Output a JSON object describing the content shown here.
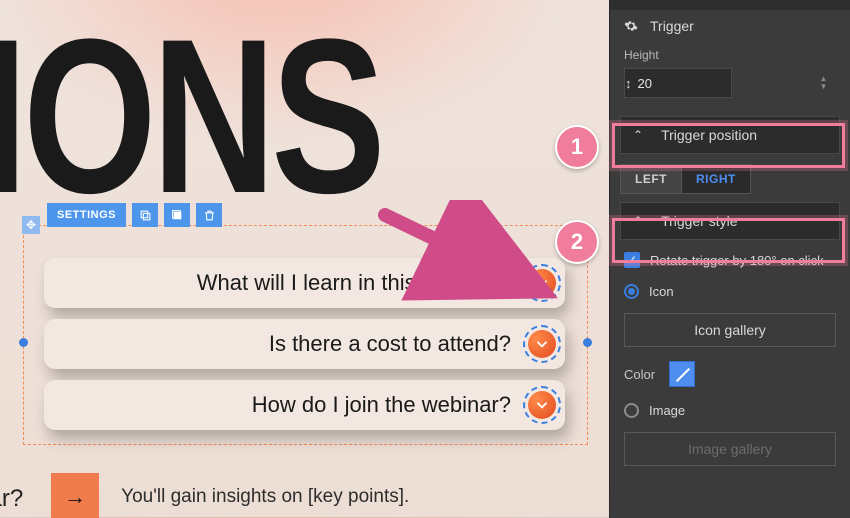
{
  "canvas": {
    "big_title": "TIONS",
    "toolbar": {
      "settings": "SETTINGS",
      "icons": [
        "copy-icon",
        "layer-icon",
        "trash-icon"
      ]
    },
    "accordion": {
      "rows": [
        {
          "q": "What will I learn in this webinar?"
        },
        {
          "q": "Is there a cost to attend?"
        },
        {
          "q": "How do I join the webinar?"
        }
      ]
    },
    "peek": {
      "title_fragment": "าar?",
      "arrow_glyph": "→",
      "body": "You'll gain insights on [key points]."
    }
  },
  "annotations": {
    "arrow_color": "#cf4c89",
    "badge1": "1",
    "badge2": "2"
  },
  "panel": {
    "title": "Trigger",
    "height_label": "Height",
    "height_value": "20",
    "sections": {
      "position": "Trigger position",
      "style": "Trigger style"
    },
    "position_options": {
      "left": "LEFT",
      "right": "RIGHT",
      "selected": "RIGHT"
    },
    "rotate_label": "Rotate trigger by 180° on click",
    "rotate_checked": true,
    "type_icon": "Icon",
    "type_image": "Image",
    "type_selected": "Icon",
    "icon_gallery": "Icon gallery",
    "image_gallery": "Image gallery",
    "color_label": "Color",
    "color_value": "#4d8ef0"
  }
}
